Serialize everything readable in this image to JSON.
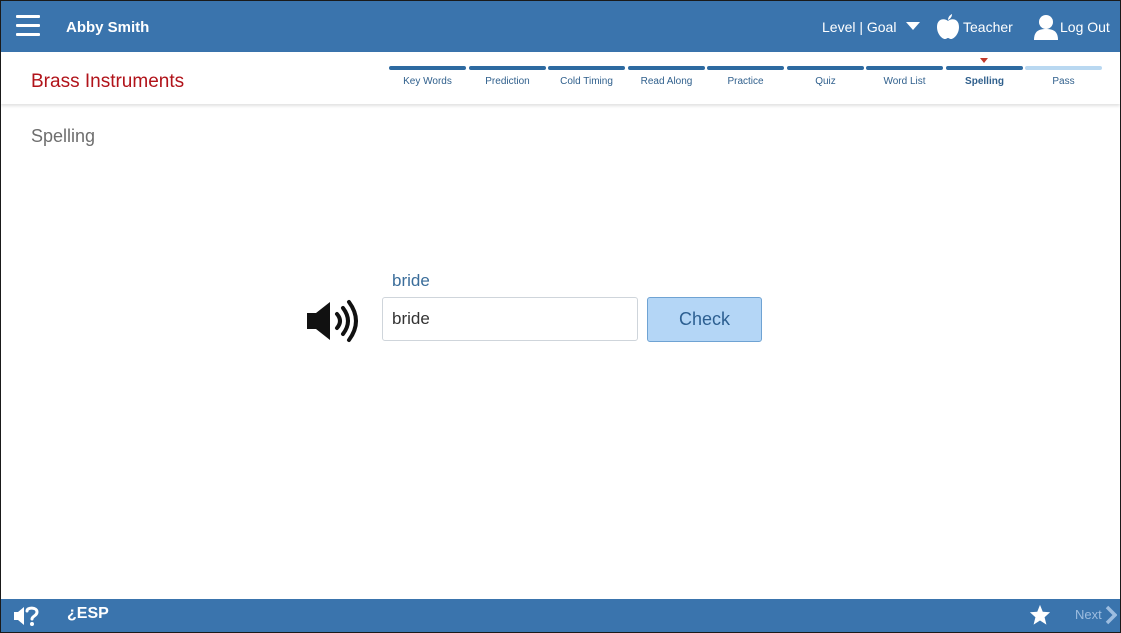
{
  "header": {
    "user_name": "Abby Smith",
    "level_goal_label": "Level | Goal",
    "teacher_label": "Teacher",
    "logout_label": "Log Out"
  },
  "lesson": {
    "title": "Brass Instruments",
    "current_step": "Spelling",
    "steps": [
      {
        "label": "Key Words",
        "state": "done"
      },
      {
        "label": "Prediction",
        "state": "done"
      },
      {
        "label": "Cold Timing",
        "state": "done"
      },
      {
        "label": "Read Along",
        "state": "done"
      },
      {
        "label": "Practice",
        "state": "done"
      },
      {
        "label": "Quiz",
        "state": "done"
      },
      {
        "label": "Word List",
        "state": "done"
      },
      {
        "label": "Spelling",
        "state": "current"
      },
      {
        "label": "Pass",
        "state": "pending"
      }
    ]
  },
  "main": {
    "section_heading": "Spelling",
    "prompt_word": "bride",
    "answer_value": "bride",
    "check_label": "Check"
  },
  "footer": {
    "esp_label": "¿ESP",
    "next_label": "Next"
  },
  "colors": {
    "header_bg": "#3a74ad",
    "title_red": "#b1131a",
    "step_done": "#2d6aa1",
    "step_pending": "#b9d8f1",
    "check_bg": "#b4d6f6"
  },
  "icons": [
    "menu-icon",
    "dropdown-arrow-icon",
    "apple-icon",
    "user-icon",
    "speaker-icon",
    "audio-help-icon",
    "star-icon",
    "chevron-right-icon"
  ]
}
